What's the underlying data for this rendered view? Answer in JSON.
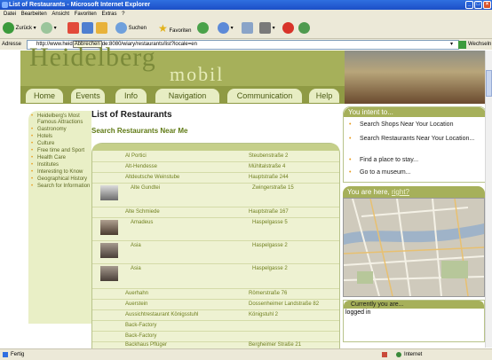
{
  "window": {
    "title": "List of Restaurants - Microsoft Internet Explorer"
  },
  "menu": [
    "Datei",
    "Bearbeiten",
    "Ansicht",
    "Favoriten",
    "Extras",
    "?"
  ],
  "toolbar": {
    "back": "Zurück",
    "search": "Suchen",
    "favorites": "Favoriten"
  },
  "address": {
    "label": "Adresse",
    "url": "http://www.heid",
    "tooltip": "Abbrechen",
    "url_rest": "de:8080/wiary/restaurants/list?locale=en",
    "go": "Wechseln zu"
  },
  "site": {
    "brand": "Heidelberg",
    "brand_sub": "mobil",
    "nav": [
      "Home",
      "Events",
      "Info",
      "Navigation",
      "Communication",
      "Help"
    ]
  },
  "sidebar": {
    "items": [
      "Heidelberg's Most Famous Attractions",
      "Gastronomy",
      "Hotels",
      "Culture",
      "Free time and Sport",
      "Health Care",
      "Institutes",
      "Interesting to Know",
      "Geographical History",
      "Search for Information"
    ]
  },
  "main": {
    "title": "List of Restaurants",
    "subtitle": "Search Restaurants Near Me",
    "rows": [
      {
        "name": "Al Portici",
        "address": "Steubenstraße 2",
        "img": false
      },
      {
        "name": "Alt-Hendesse",
        "address": "Mühltalstraße 4",
        "img": false
      },
      {
        "name": "Altdeutsche Weinstube",
        "address": "Hauptstraße 244",
        "img": false
      },
      {
        "name": "Alte Gundtei",
        "address": "Zwingerstraße 15",
        "img": true
      },
      {
        "name": "Alte Schmiede",
        "address": "Hauptstraße 167",
        "img": false
      },
      {
        "name": "Amadeus",
        "address": "Haspelgasse 5",
        "img": true
      },
      {
        "name": "Asia",
        "address": "Haspelgasse 2",
        "img": true
      },
      {
        "name": "Asia",
        "address": "Haspelgasse 2",
        "img": true
      },
      {
        "name": "Auerhahn",
        "address": "Römerstraße 76",
        "img": false
      },
      {
        "name": "Auerstein",
        "address": "Dossenheimer Landstraße 82",
        "img": false
      },
      {
        "name": "Aussichtrestaurant Königsstuhl",
        "address": "Königstuhl 2",
        "img": false
      },
      {
        "name": "Back-Factory",
        "address": "",
        "img": false
      },
      {
        "name": "Back-Factory",
        "address": "",
        "img": false
      },
      {
        "name": "Backhaus Pflüger",
        "address": "Bergheimer Straße 21",
        "img": false
      }
    ]
  },
  "right": {
    "intent_header": "You intent to...",
    "intent_items": [
      "Search Shops Near Your Location",
      "Search Restaurants Near Your Location...",
      "Find a place to stay...",
      "Go to a museum..."
    ],
    "here_header": "You are here,",
    "here_link": "right?",
    "current_header": "Currently you are...",
    "current_text": "logged in"
  },
  "status": {
    "left": "Fertig",
    "right": "Internet"
  },
  "colors": {
    "olive": "#a6b05a",
    "dark_olive": "#8f9a44",
    "light_olive": "#e7edc3",
    "bullet": "#e89a1a"
  }
}
